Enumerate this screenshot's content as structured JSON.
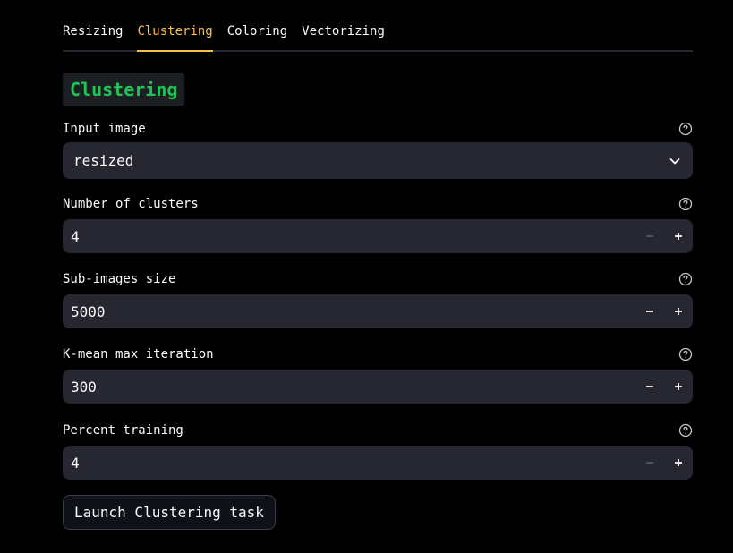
{
  "tabs": [
    {
      "label": "Resizing",
      "active": false
    },
    {
      "label": "Clustering",
      "active": true
    },
    {
      "label": "Coloring",
      "active": false
    },
    {
      "label": "Vectorizing",
      "active": false
    }
  ],
  "section": {
    "heading": "Clustering"
  },
  "fields": {
    "input_image": {
      "label": "Input image",
      "value": "resized",
      "help_icon": "question-circle-icon",
      "dropdown_icon": "chevron-down-icon"
    },
    "num_clusters": {
      "label": "Number of clusters",
      "value": "4",
      "help_icon": "question-circle-icon",
      "minus_disabled": true
    },
    "sub_images_size": {
      "label": "Sub-images size",
      "value": "5000",
      "help_icon": "question-circle-icon",
      "minus_disabled": false
    },
    "kmean_max_iter": {
      "label": "K-mean max iteration",
      "value": "300",
      "help_icon": "question-circle-icon",
      "minus_disabled": false
    },
    "percent_training": {
      "label": "Percent training",
      "value": "4",
      "help_icon": "question-circle-icon",
      "minus_disabled": true
    }
  },
  "actions": {
    "launch_label": "Launch Clustering task"
  },
  "colors": {
    "background": "#000000",
    "accent_tab": "#ffbd45",
    "heading_text": "#21c354",
    "input_bg": "#262730",
    "text": "#fafafa",
    "disabled": "#555861"
  }
}
